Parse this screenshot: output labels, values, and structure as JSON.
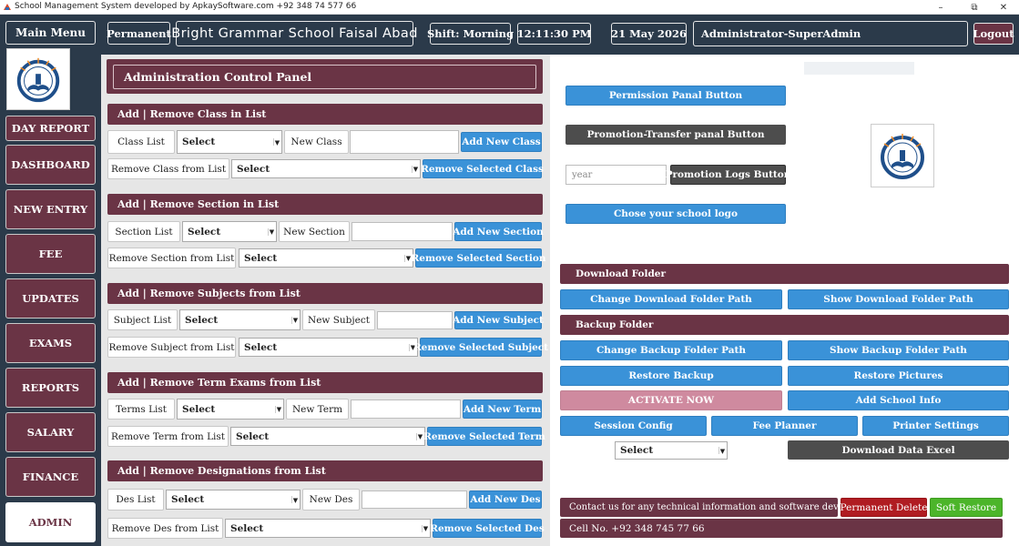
{
  "window": {
    "title": "School Management System developed by ApkaySoftware.com +92 348 74 577 66",
    "minimize": "–",
    "maximize": "⧉",
    "close": "✕"
  },
  "topbar": {
    "main_menu": "Main Menu",
    "permanent": "Permanent",
    "school_name": "Bright Grammar School Faisal Abad",
    "shift": "Shift: Morning",
    "time": "12:11:30 PM",
    "date": "21 May 2026",
    "user": "Administrator-SuperAdmin",
    "logout": "Logout"
  },
  "sidebar": {
    "items": [
      {
        "label": "DAY REPORT"
      },
      {
        "label": "DASHBOARD"
      },
      {
        "label": "NEW ENTRY"
      },
      {
        "label": "FEE"
      },
      {
        "label": "UPDATES"
      },
      {
        "label": "EXAMS"
      },
      {
        "label": "REPORTS"
      },
      {
        "label": "SALARY"
      },
      {
        "label": "FINANCE"
      },
      {
        "label": "ADMIN"
      }
    ]
  },
  "panel": {
    "title": "Administration Control Panel",
    "sections": [
      {
        "header": "Add | Remove Class in List",
        "list_label": "Class  List",
        "list_value": "Select",
        "new_label": "New Class",
        "new_placeholder": "",
        "add_button": "Add New Class",
        "remove_label": "Remove Class from List",
        "remove_value": "Select",
        "remove_button": "Remove  Selected Class"
      },
      {
        "header": "Add | Remove Section in List",
        "list_label": "Section  List",
        "list_value": "Select",
        "new_label": "New Section",
        "new_placeholder": "",
        "add_button": "Add New Section",
        "remove_label": "Remove Section from List",
        "remove_value": "Select",
        "remove_button": "Remove  Selected Section"
      },
      {
        "header": "Add | Remove Subjects from List",
        "list_label": "Subject List",
        "list_value": "Select",
        "new_label": "New Subject",
        "new_placeholder": "",
        "add_button": "Add New Subject",
        "remove_label": "Remove Subject from List",
        "remove_value": "Select",
        "remove_button": "Remove Selected Subject"
      },
      {
        "header": "Add | Remove Term Exams from List",
        "list_label": "Terms List",
        "list_value": "Select",
        "new_label": "New Term",
        "new_placeholder": "",
        "add_button": "Add New Term",
        "remove_label": "Remove Term from List",
        "remove_value": "Select",
        "remove_button": "Remove Selected Term"
      },
      {
        "header": "Add | Remove Designations from List",
        "list_label": "Des List",
        "list_value": "Select",
        "new_label": "New Des",
        "new_placeholder": "",
        "add_button": "Add New Des",
        "remove_label": "Remove Des from List",
        "remove_value": "Select",
        "remove_button": "Remove Selected Des"
      }
    ]
  },
  "right": {
    "permission_button": "Permission Panal Button",
    "promotion_button": "Promotion-Transfer panal Button",
    "year_placeholder": "year",
    "promotion_logs_button": "Promotion Logs Button",
    "logo_button": "Chose your school logo",
    "download_folder_header": "Download Folder",
    "change_download": "Change Download Folder Path",
    "show_download": "Show Download Folder Path",
    "backup_folder_header": "Backup Folder",
    "change_backup": "Change Backup Folder Path",
    "show_backup": "Show Backup Folder Path",
    "restore_backup": "Restore Backup",
    "restore_pictures": "Restore Pictures",
    "activate_now": "ACTIVATE NOW",
    "add_school_info": "Add School Info",
    "session_config": "Session Config",
    "fee_planner": "Fee Planner",
    "printer_settings": "Printer Settings",
    "select_value": "Select",
    "download_excel": "Download Data Excel",
    "contact_text": "Contact us  for any technical information and software development",
    "permanent_delete": "Permanent  Delete",
    "soft_restore": "Soft Restore",
    "cell_no": "Cell No. +92 348 745 77 66"
  },
  "colors": {
    "navy": "#2b3a4a",
    "maroon": "#6a3445",
    "blue": "#3a92d8",
    "dark": "#4d4d4d",
    "pink": "#cf8a9f",
    "red": "#b01c22",
    "green": "#4cb52a"
  }
}
